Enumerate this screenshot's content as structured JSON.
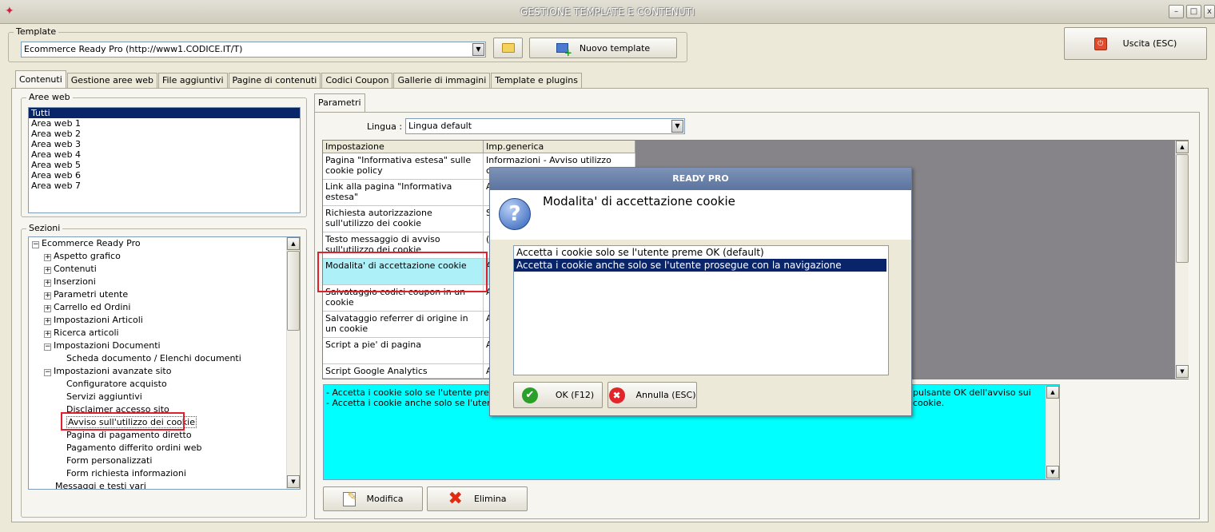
{
  "window": {
    "title": "GESTIONE TEMPLATE E CONTENUTI"
  },
  "template_group": {
    "legend": "Template",
    "selected": "Ecommerce Ready Pro (http://www1.CODICE.IT/T)",
    "new_button": "Nuovo template"
  },
  "exit_button": "Uscita (ESC)",
  "tabs": [
    "Contenuti",
    "Gestione aree web",
    "File aggiuntivi",
    "Pagine di contenuti",
    "Codici Coupon",
    "Gallerie di immagini",
    "Template e plugins"
  ],
  "aree_web": {
    "legend": "Aree web",
    "items": [
      "Tutti",
      "Area web 1",
      "Area web 2",
      "Area web 3",
      "Area web 4",
      "Area web 5",
      "Area web 6",
      "Area web 7"
    ]
  },
  "sezioni": {
    "legend": "Sezioni",
    "root": "Ecommerce Ready Pro",
    "items": [
      "Aspetto grafico",
      "Contenuti",
      "Inserzioni",
      "Parametri utente",
      "Carrello ed Ordini",
      "Impostazioni Articoli",
      "Ricerca articoli",
      "Impostazioni Documenti",
      "Scheda documento / Elenchi documenti",
      "Impostazioni avanzate sito",
      "Configuratore acquisto",
      "Servizi aggiuntivi",
      "Disclaimer accesso sito",
      "Avviso sull'utilizzo dei cookie",
      "Pagina di pagamento diretto",
      "Pagamento differito ordini web",
      "Form personalizzati",
      "Form richiesta informazioni",
      "Messaggi e testi vari"
    ]
  },
  "parametri": {
    "tab": "Parametri",
    "lingua_label": "Lingua :",
    "lingua_value": "Lingua default",
    "columns": [
      "Impostazione",
      "Imp.generica"
    ],
    "rows": [
      {
        "name": "Pagina \"Informativa estesa\" sulle cookie policy",
        "value": "Informazioni - Avviso utilizzo cookie"
      },
      {
        "name": "Link alla pagina \"Informativa estesa\"",
        "value": "A"
      },
      {
        "name": "Richiesta autorizzazione sull'utilizzo dei cookie",
        "value": "S"
      },
      {
        "name": "Testo messaggio di avviso sull'utilizzo dei cookie",
        "value": "("
      },
      {
        "name": "Modalita' di accettazione cookie",
        "value": "A p"
      },
      {
        "name": "Salvataggio codici coupon in un cookie",
        "value": "A ("
      },
      {
        "name": "Salvataggio referrer di origine in un cookie",
        "value": "A ("
      },
      {
        "name": "Script a pie' di pagina",
        "value": "A ("
      },
      {
        "name": "Script Google Analytics",
        "value": "A"
      }
    ],
    "description_lines": [
      "- Accetta i cookie solo se l'utente preme OK",
      "- Accetta i cookie anche solo se l'utente pro"
    ],
    "description_tail": "pulsante OK dell'avviso sui cookie.",
    "modify_button": "Modifica",
    "delete_button": "Elimina"
  },
  "dialog": {
    "title": "READY PRO",
    "heading": "Modalita' di accettazione cookie",
    "options": [
      "Accetta i cookie solo se l'utente preme OK (default)",
      "Accetta i cookie anche solo se l'utente prosegue con la navigazione"
    ],
    "selected_index": 1,
    "ok_button": "OK (F12)",
    "cancel_button": "Annulla (ESC)"
  },
  "colors": {
    "selection": "#0a246a",
    "highlight_row": "#aef0f8",
    "description_bg": "#00ffff",
    "red_box": "#e0202c",
    "grid_bg": "#868488"
  }
}
